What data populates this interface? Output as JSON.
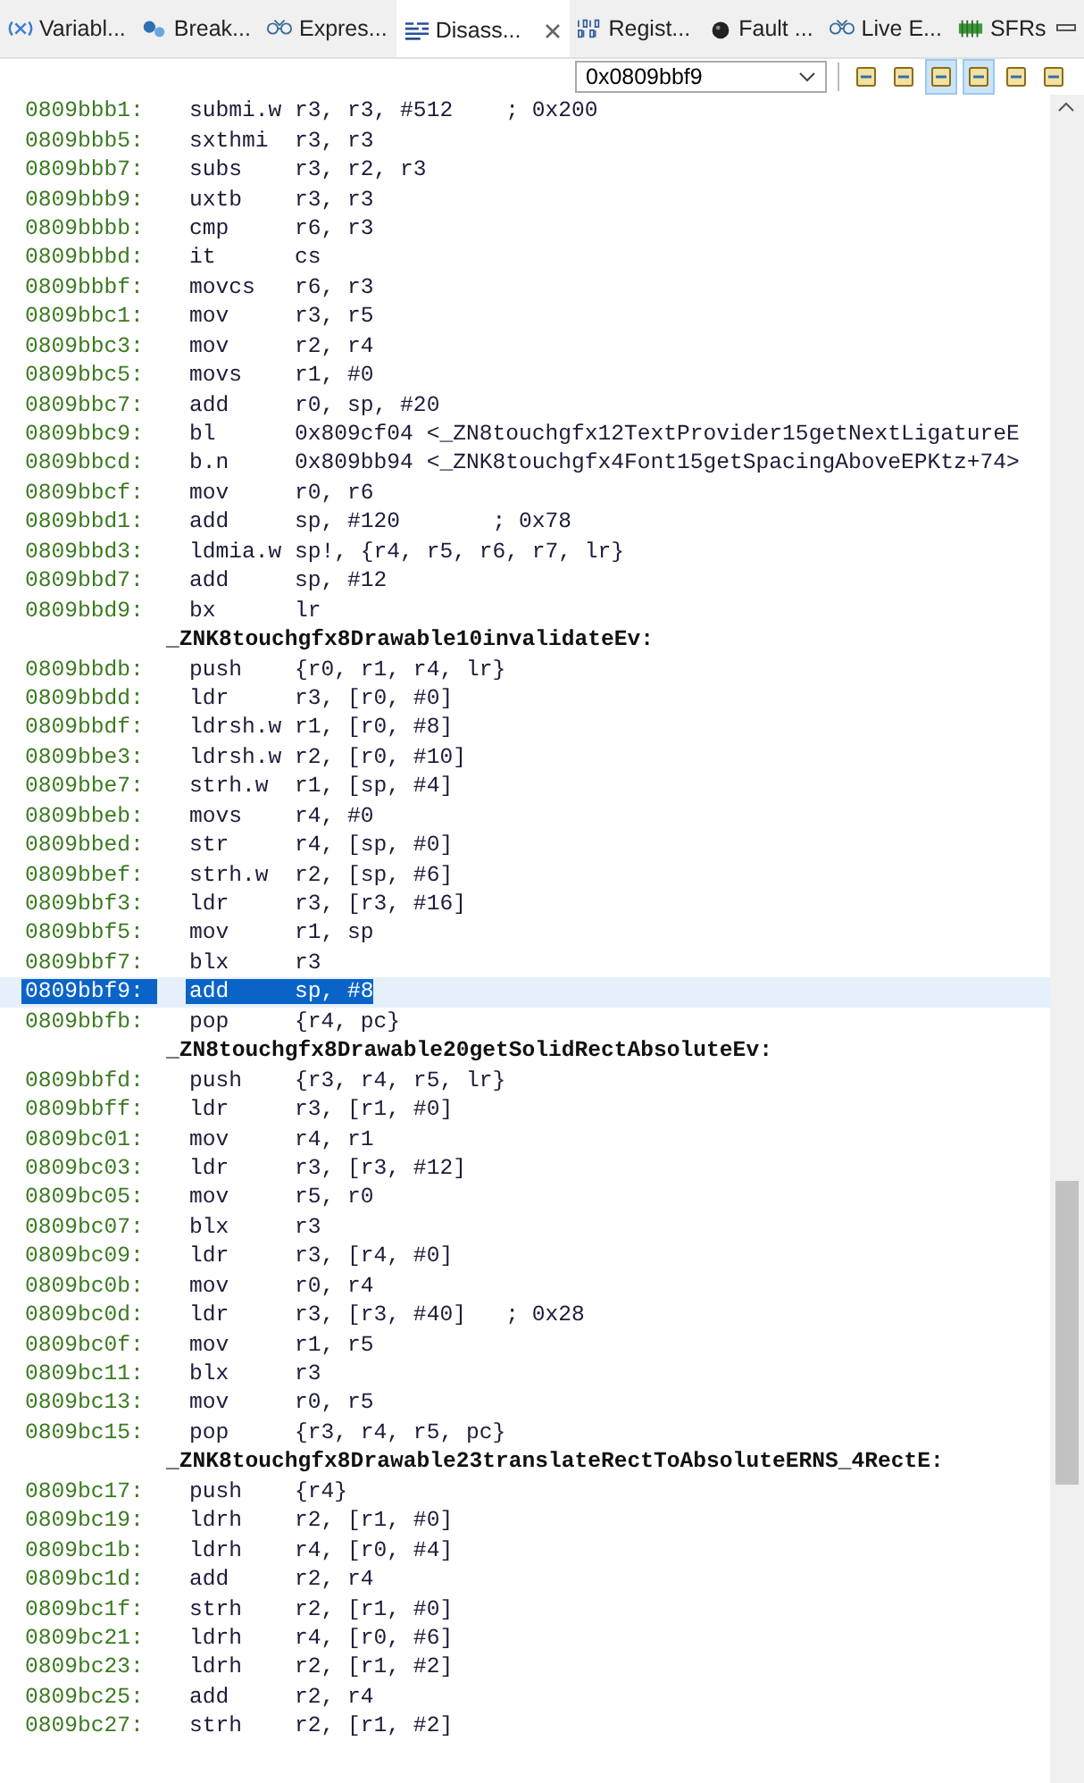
{
  "tabs": [
    {
      "label": "Variabl...",
      "selected": false
    },
    {
      "label": "Break...",
      "selected": false
    },
    {
      "label": "Expres...",
      "selected": false
    },
    {
      "label": "Disass...",
      "selected": true
    },
    {
      "label": "Regist...",
      "selected": false
    },
    {
      "label": "Fault ...",
      "selected": false
    },
    {
      "label": "Live E...",
      "selected": false
    },
    {
      "label": "SFRs",
      "selected": false
    }
  ],
  "address_field": {
    "value": "0x0809bbf9"
  },
  "toolbar": [
    {
      "on": false
    },
    {
      "on": false
    },
    {
      "on": true
    },
    {
      "on": true
    },
    {
      "on": false
    },
    {
      "on": false
    }
  ],
  "lines": [
    {
      "kind": "ins",
      "address": "0809bbb1:",
      "mnemonic": "submi.w",
      "operands": "r3, r3, #512    ; 0x200",
      "selected": false
    },
    {
      "kind": "ins",
      "address": "0809bbb5:",
      "mnemonic": "sxthmi",
      "operands": "r3, r3",
      "selected": false
    },
    {
      "kind": "ins",
      "address": "0809bbb7:",
      "mnemonic": "subs",
      "operands": "r3, r2, r3",
      "selected": false
    },
    {
      "kind": "ins",
      "address": "0809bbb9:",
      "mnemonic": "uxtb",
      "operands": "r3, r3",
      "selected": false
    },
    {
      "kind": "ins",
      "address": "0809bbbb:",
      "mnemonic": "cmp",
      "operands": "r6, r3",
      "selected": false
    },
    {
      "kind": "ins",
      "address": "0809bbbd:",
      "mnemonic": "it",
      "operands": "cs",
      "selected": false
    },
    {
      "kind": "ins",
      "address": "0809bbbf:",
      "mnemonic": "movcs",
      "operands": "r6, r3",
      "selected": false
    },
    {
      "kind": "ins",
      "address": "0809bbc1:",
      "mnemonic": "mov",
      "operands": "r3, r5",
      "selected": false
    },
    {
      "kind": "ins",
      "address": "0809bbc3:",
      "mnemonic": "mov",
      "operands": "r2, r4",
      "selected": false
    },
    {
      "kind": "ins",
      "address": "0809bbc5:",
      "mnemonic": "movs",
      "operands": "r1, #0",
      "selected": false
    },
    {
      "kind": "ins",
      "address": "0809bbc7:",
      "mnemonic": "add",
      "operands": "r0, sp, #20",
      "selected": false
    },
    {
      "kind": "ins",
      "address": "0809bbc9:",
      "mnemonic": "bl",
      "operands": "0x809cf04 <_ZN8touchgfx12TextProvider15getNextLigatureE",
      "selected": false
    },
    {
      "kind": "ins",
      "address": "0809bbcd:",
      "mnemonic": "b.n",
      "operands": "0x809bb94 <_ZNK8touchgfx4Font15getSpacingAboveEPKtz+74>",
      "selected": false
    },
    {
      "kind": "ins",
      "address": "0809bbcf:",
      "mnemonic": "mov",
      "operands": "r0, r6",
      "selected": false
    },
    {
      "kind": "ins",
      "address": "0809bbd1:",
      "mnemonic": "add",
      "operands": "sp, #120       ; 0x78",
      "selected": false
    },
    {
      "kind": "ins",
      "address": "0809bbd3:",
      "mnemonic": "ldmia.w",
      "operands": "sp!, {r4, r5, r6, r7, lr}",
      "selected": false
    },
    {
      "kind": "ins",
      "address": "0809bbd7:",
      "mnemonic": "add",
      "operands": "sp, #12",
      "selected": false
    },
    {
      "kind": "ins",
      "address": "0809bbd9:",
      "mnemonic": "bx",
      "operands": "lr",
      "selected": false
    },
    {
      "kind": "label",
      "text": "_ZNK8touchgfx8Drawable10invalidateEv:",
      "selected": false
    },
    {
      "kind": "ins",
      "address": "0809bbdb:",
      "mnemonic": "push",
      "operands": "{r0, r1, r4, lr}",
      "selected": false
    },
    {
      "kind": "ins",
      "address": "0809bbdd:",
      "mnemonic": "ldr",
      "operands": "r3, [r0, #0]",
      "selected": false
    },
    {
      "kind": "ins",
      "address": "0809bbdf:",
      "mnemonic": "ldrsh.w",
      "operands": "r1, [r0, #8]",
      "selected": false
    },
    {
      "kind": "ins",
      "address": "0809bbe3:",
      "mnemonic": "ldrsh.w",
      "operands": "r2, [r0, #10]",
      "selected": false
    },
    {
      "kind": "ins",
      "address": "0809bbe7:",
      "mnemonic": "strh.w",
      "operands": "r1, [sp, #4]",
      "selected": false
    },
    {
      "kind": "ins",
      "address": "0809bbeb:",
      "mnemonic": "movs",
      "operands": "r4, #0",
      "selected": false
    },
    {
      "kind": "ins",
      "address": "0809bbed:",
      "mnemonic": "str",
      "operands": "r4, [sp, #0]",
      "selected": false
    },
    {
      "kind": "ins",
      "address": "0809bbef:",
      "mnemonic": "strh.w",
      "operands": "r2, [sp, #6]",
      "selected": false
    },
    {
      "kind": "ins",
      "address": "0809bbf3:",
      "mnemonic": "ldr",
      "operands": "r3, [r3, #16]",
      "selected": false
    },
    {
      "kind": "ins",
      "address": "0809bbf5:",
      "mnemonic": "mov",
      "operands": "r1, sp",
      "selected": false
    },
    {
      "kind": "ins",
      "address": "0809bbf7:",
      "mnemonic": "blx",
      "operands": "r3",
      "selected": false
    },
    {
      "kind": "ins",
      "address": "0809bbf9:",
      "mnemonic": "add",
      "operands": "sp, #8",
      "selected": true
    },
    {
      "kind": "ins",
      "address": "0809bbfb:",
      "mnemonic": "pop",
      "operands": "{r4, pc}",
      "selected": false
    },
    {
      "kind": "label",
      "text": "_ZN8touchgfx8Drawable20getSolidRectAbsoluteEv:",
      "selected": false
    },
    {
      "kind": "ins",
      "address": "0809bbfd:",
      "mnemonic": "push",
      "operands": "{r3, r4, r5, lr}",
      "selected": false
    },
    {
      "kind": "ins",
      "address": "0809bbff:",
      "mnemonic": "ldr",
      "operands": "r3, [r1, #0]",
      "selected": false
    },
    {
      "kind": "ins",
      "address": "0809bc01:",
      "mnemonic": "mov",
      "operands": "r4, r1",
      "selected": false
    },
    {
      "kind": "ins",
      "address": "0809bc03:",
      "mnemonic": "ldr",
      "operands": "r3, [r3, #12]",
      "selected": false
    },
    {
      "kind": "ins",
      "address": "0809bc05:",
      "mnemonic": "mov",
      "operands": "r5, r0",
      "selected": false
    },
    {
      "kind": "ins",
      "address": "0809bc07:",
      "mnemonic": "blx",
      "operands": "r3",
      "selected": false
    },
    {
      "kind": "ins",
      "address": "0809bc09:",
      "mnemonic": "ldr",
      "operands": "r3, [r4, #0]",
      "selected": false
    },
    {
      "kind": "ins",
      "address": "0809bc0b:",
      "mnemonic": "mov",
      "operands": "r0, r4",
      "selected": false
    },
    {
      "kind": "ins",
      "address": "0809bc0d:",
      "mnemonic": "ldr",
      "operands": "r3, [r3, #40]   ; 0x28",
      "selected": false
    },
    {
      "kind": "ins",
      "address": "0809bc0f:",
      "mnemonic": "mov",
      "operands": "r1, r5",
      "selected": false
    },
    {
      "kind": "ins",
      "address": "0809bc11:",
      "mnemonic": "blx",
      "operands": "r3",
      "selected": false
    },
    {
      "kind": "ins",
      "address": "0809bc13:",
      "mnemonic": "mov",
      "operands": "r0, r5",
      "selected": false
    },
    {
      "kind": "ins",
      "address": "0809bc15:",
      "mnemonic": "pop",
      "operands": "{r3, r4, r5, pc}",
      "selected": false
    },
    {
      "kind": "label",
      "text": "_ZNK8touchgfx8Drawable23translateRectToAbsoluteERNS_4RectE:",
      "selected": false
    },
    {
      "kind": "ins",
      "address": "0809bc17:",
      "mnemonic": "push",
      "operands": "{r4}",
      "selected": false
    },
    {
      "kind": "ins",
      "address": "0809bc19:",
      "mnemonic": "ldrh",
      "operands": "r2, [r1, #0]",
      "selected": false
    },
    {
      "kind": "ins",
      "address": "0809bc1b:",
      "mnemonic": "ldrh",
      "operands": "r4, [r0, #4]",
      "selected": false
    },
    {
      "kind": "ins",
      "address": "0809bc1d:",
      "mnemonic": "add",
      "operands": "r2, r4",
      "selected": false
    },
    {
      "kind": "ins",
      "address": "0809bc1f:",
      "mnemonic": "strh",
      "operands": "r2, [r1, #0]",
      "selected": false
    },
    {
      "kind": "ins",
      "address": "0809bc21:",
      "mnemonic": "ldrh",
      "operands": "r4, [r0, #6]",
      "selected": false
    },
    {
      "kind": "ins",
      "address": "0809bc23:",
      "mnemonic": "ldrh",
      "operands": "r2, [r1, #2]",
      "selected": false
    },
    {
      "kind": "ins",
      "address": "0809bc25:",
      "mnemonic": "add",
      "operands": "r2, r4",
      "selected": false
    },
    {
      "kind": "ins",
      "address": "0809bc27:",
      "mnemonic": "strh",
      "operands": "r2, [r1, #2]",
      "selected": false
    }
  ]
}
